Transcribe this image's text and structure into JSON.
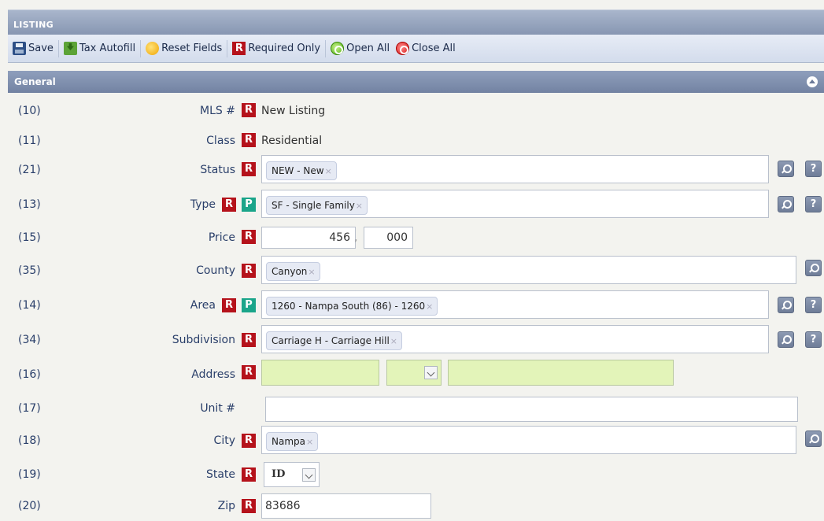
{
  "header": {
    "title": "LISTING"
  },
  "toolbar": {
    "save": "Save",
    "tax_autofill": "Tax Autofill",
    "reset_fields": "Reset Fields",
    "required_only": "Required Only",
    "open_all": "Open All",
    "close_all": "Close All"
  },
  "section": {
    "title": "General"
  },
  "badges": {
    "required": "R",
    "p": "P",
    "help": "?"
  },
  "fields": {
    "mls": {
      "num": "(10)",
      "label": "MLS #",
      "value": "New Listing"
    },
    "class": {
      "num": "(11)",
      "label": "Class",
      "value": "Residential"
    },
    "status": {
      "num": "(21)",
      "label": "Status",
      "value": "NEW - New"
    },
    "type": {
      "num": "(13)",
      "label": "Type",
      "value": "SF - Single Family"
    },
    "price": {
      "num": "(15)",
      "label": "Price",
      "value_thousands": "456",
      "separator": ",",
      "value_units": "000"
    },
    "county": {
      "num": "(35)",
      "label": "County",
      "value": "Canyon"
    },
    "area": {
      "num": "(14)",
      "label": "Area",
      "value": "1260 - Nampa South (86) - 1260"
    },
    "subdivision": {
      "num": "(34)",
      "label": "Subdivision",
      "value": "Carriage H - Carriage Hill"
    },
    "address": {
      "num": "(16)",
      "label": "Address"
    },
    "unit": {
      "num": "(17)",
      "label": "Unit #",
      "value": ""
    },
    "city": {
      "num": "(18)",
      "label": "City",
      "value": "Nampa"
    },
    "state": {
      "num": "(19)",
      "label": "State",
      "value": "ID"
    },
    "zip": {
      "num": "(20)",
      "label": "Zip",
      "value": "83686"
    }
  },
  "chip_remove": "×"
}
